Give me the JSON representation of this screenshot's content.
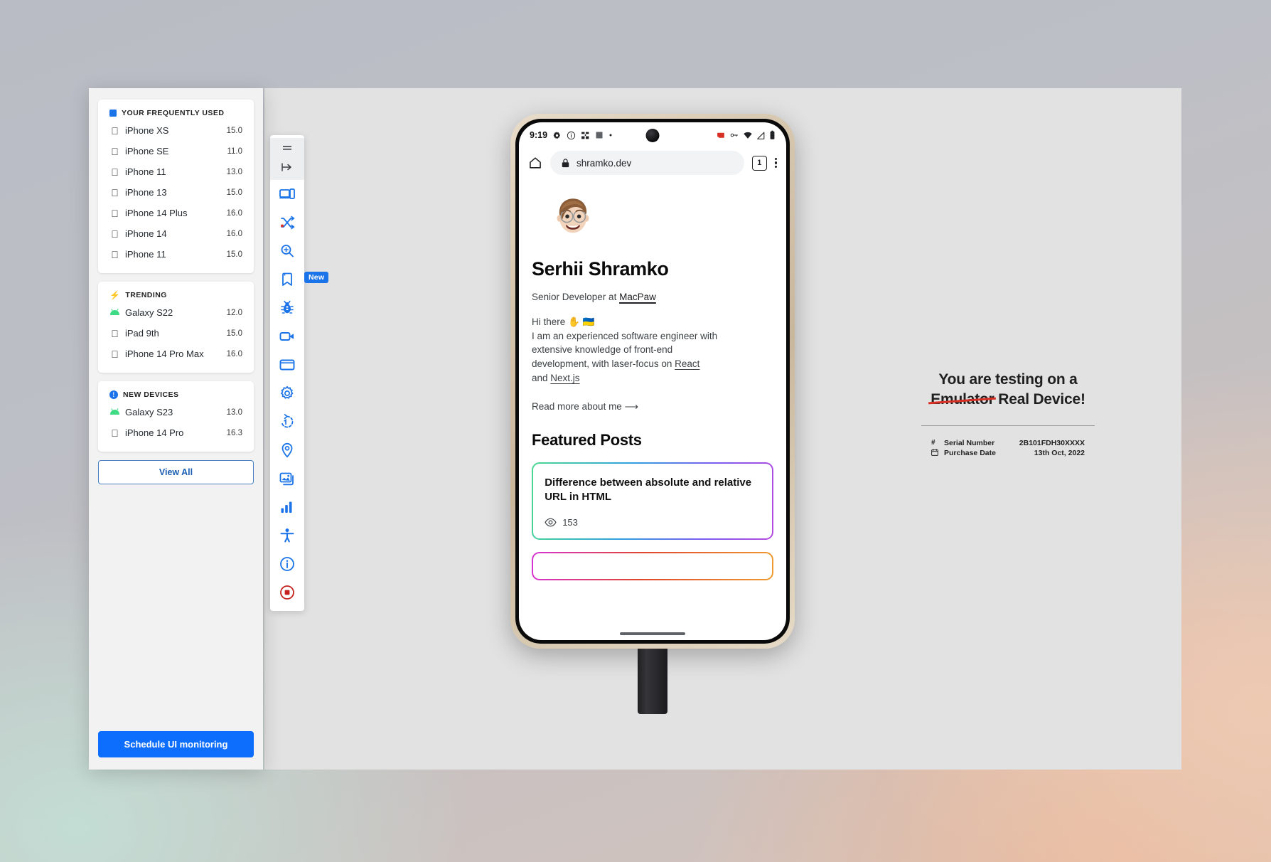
{
  "sidebar": {
    "sections": [
      {
        "title": "YOUR FREQUENTLY USED",
        "icon": "blue-square-icon",
        "devices": [
          {
            "platform": "apple",
            "name": "iPhone XS",
            "version": "15.0"
          },
          {
            "platform": "apple",
            "name": "iPhone SE",
            "version": "11.0"
          },
          {
            "platform": "apple",
            "name": "iPhone 11",
            "version": "13.0"
          },
          {
            "platform": "apple",
            "name": "iPhone 13",
            "version": "15.0"
          },
          {
            "platform": "apple",
            "name": "iPhone 14 Plus",
            "version": "16.0"
          },
          {
            "platform": "apple",
            "name": "iPhone 14",
            "version": "16.0"
          },
          {
            "platform": "apple",
            "name": "iPhone 11",
            "version": "15.0"
          }
        ]
      },
      {
        "title": "TRENDING",
        "icon": "bolt-icon",
        "devices": [
          {
            "platform": "android",
            "name": "Galaxy S22",
            "version": "12.0"
          },
          {
            "platform": "apple",
            "name": "iPad 9th",
            "version": "15.0"
          },
          {
            "platform": "apple",
            "name": "iPhone 14 Pro Max",
            "version": "16.0"
          }
        ]
      },
      {
        "title": "NEW DEVICES",
        "icon": "info-circle-icon",
        "devices": [
          {
            "platform": "android",
            "name": "Galaxy S23",
            "version": "13.0"
          },
          {
            "platform": "apple",
            "name": "iPhone 14 Pro",
            "version": "16.3"
          }
        ]
      }
    ],
    "view_all_label": "View All",
    "schedule_label": "Schedule UI monitoring"
  },
  "toolbar": {
    "badge": "New",
    "items": [
      {
        "name": "menu-icon"
      },
      {
        "name": "arrow-to-right-icon"
      },
      {
        "name": "responsive-devices-icon"
      },
      {
        "name": "shuffle-network-icon"
      },
      {
        "name": "zoom-in-icon"
      },
      {
        "name": "bookmark-icon"
      },
      {
        "name": "bug-icon"
      },
      {
        "name": "video-camera-icon"
      },
      {
        "name": "window-icon"
      },
      {
        "name": "gear-icon"
      },
      {
        "name": "rotate-icon"
      },
      {
        "name": "location-pin-icon"
      },
      {
        "name": "image-gallery-icon"
      },
      {
        "name": "bar-chart-icon"
      },
      {
        "name": "accessibility-icon"
      },
      {
        "name": "info-icon"
      },
      {
        "name": "stop-record-icon"
      }
    ]
  },
  "phone": {
    "status": {
      "clock": "9:19",
      "left_icons": [
        "gear-icon",
        "info-circle-icon",
        "tools-icon",
        "square-icon",
        "dot-icon"
      ],
      "right_icons": [
        "cast-icon",
        "vpn-key-icon",
        "wifi-icon",
        "signal-icon",
        "battery-icon"
      ]
    },
    "browser": {
      "home_icon": "home-icon",
      "lock_icon": "lock-icon",
      "url": "shramko.dev",
      "tab_count": "1",
      "menu_icon": "kebab-menu-icon"
    },
    "content": {
      "avatar": "memoji-avatar",
      "name": "Serhii Shramko",
      "role_prefix": "Senior Developer at",
      "role_company": "MacPaw",
      "bio_greeting": "Hi there ✋ 🇺🇦",
      "bio_line1": "I am an experienced software engineer with",
      "bio_line2": "extensive knowledge of front-end",
      "bio_line3_prefix": "development, with laser-focus on",
      "bio_link_react": "React",
      "bio_and": "and",
      "bio_link_next": "Next.js",
      "read_more": "Read more about me",
      "read_more_arrow": "⟶",
      "featured_heading": "Featured Posts",
      "posts": [
        {
          "title": "Difference between absolute and relative URL in HTML",
          "views": "153",
          "views_icon": "eye-icon"
        }
      ]
    }
  },
  "info_panel": {
    "headline_line1": "You are testing on a",
    "headline_struck": "Emulator",
    "headline_rest": "Real Device!",
    "rows": [
      {
        "icon": "hash-icon",
        "icon_glyph": "#",
        "label": "Serial Number",
        "value": "2B101FDH30XXXX"
      },
      {
        "icon": "calendar-icon",
        "icon_glyph": "Ὄ5",
        "label": "Purchase Date",
        "value": "13th Oct, 2022"
      }
    ]
  },
  "colors": {
    "accent_blue": "#1a73e8",
    "primary_button": "#0d6efd",
    "android_green": "#3ddc84",
    "strike_red": "#d93025"
  }
}
